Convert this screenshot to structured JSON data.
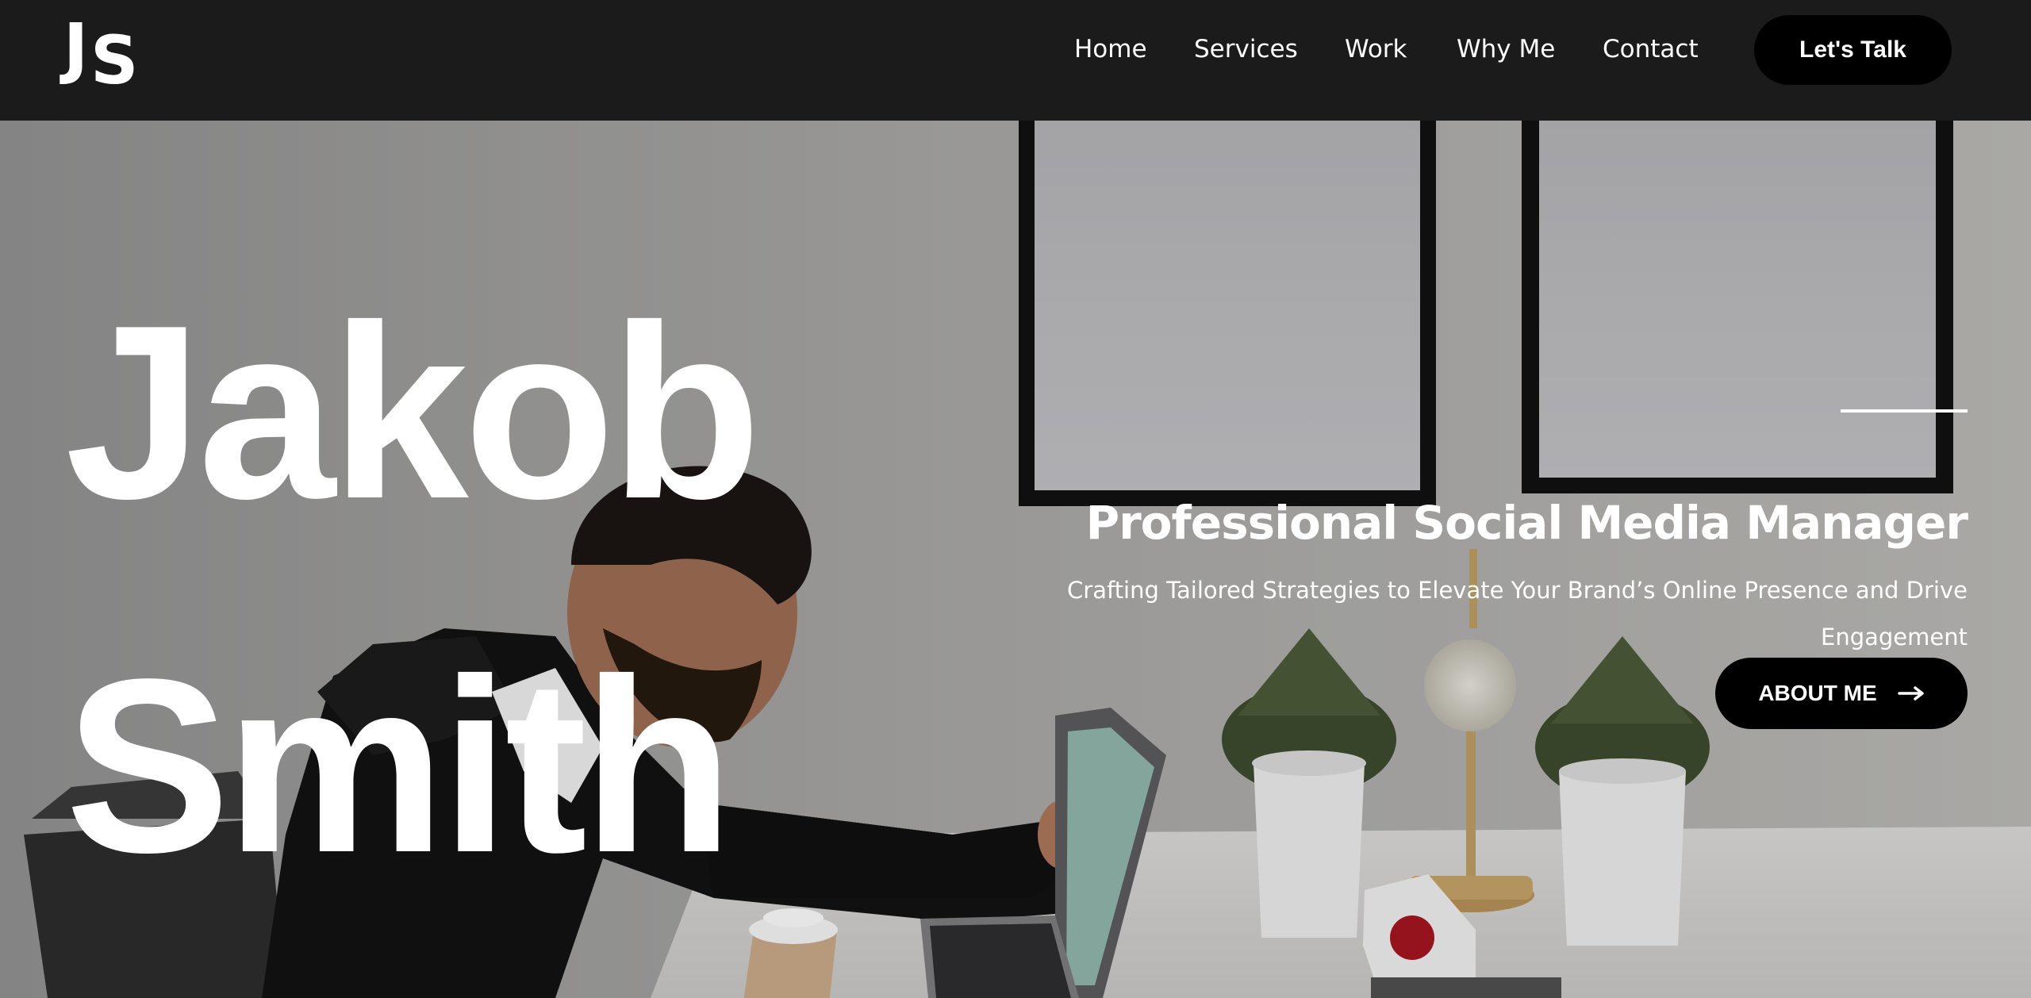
{
  "header": {
    "logo": {
      "letter_1": "J",
      "letter_2": "S"
    },
    "nav": {
      "home": "Home",
      "services": "Services",
      "work": "Work",
      "why_me": "Why Me",
      "contact": "Contact"
    },
    "cta_label": "Let's Talk"
  },
  "hero": {
    "name_first": "Jakob",
    "name_last": "Smith",
    "title": "Professional Social Media Manager",
    "subtitle": "Crafting Tailored Strategies to Elevate Your Brand’s Online Presence and Drive Engagement",
    "button_label": "ABOUT ME",
    "button_icon": "arrow-right-icon"
  },
  "colors": {
    "header_bg": "#1b1b1b",
    "button_bg": "#000000",
    "text": "#ffffff"
  }
}
